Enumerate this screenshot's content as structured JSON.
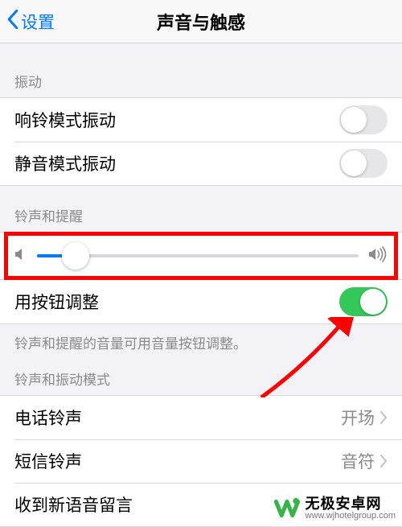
{
  "nav": {
    "back_label": "设置",
    "title": "声音与触感"
  },
  "sections": {
    "vibrate": {
      "header": "振动",
      "ring_vibrate": {
        "label": "响铃模式振动",
        "on": false
      },
      "silent_vibrate": {
        "label": "静音模式振动",
        "on": false
      }
    },
    "ringer": {
      "header": "铃声和提醒",
      "volume_percent": 12,
      "change_with_buttons": {
        "label": "用按钮调整",
        "on": true
      },
      "footnote": "铃声和提醒的音量可用音量按钮调整。"
    },
    "patterns": {
      "header": "铃声和振动模式",
      "ringtone": {
        "label": "电话铃声",
        "value": "开场"
      },
      "text_tone": {
        "label": "短信铃声",
        "value": "音符"
      },
      "voicemail": {
        "label": "收到新语音留言"
      }
    }
  },
  "watermark": {
    "name": "无极安卓网",
    "url": "www.wjhotelgroup.com"
  },
  "colors": {
    "accent": "#007aff",
    "switch_on": "#34c759",
    "highlight": "#ff0000",
    "arrow": "#ff0000"
  }
}
